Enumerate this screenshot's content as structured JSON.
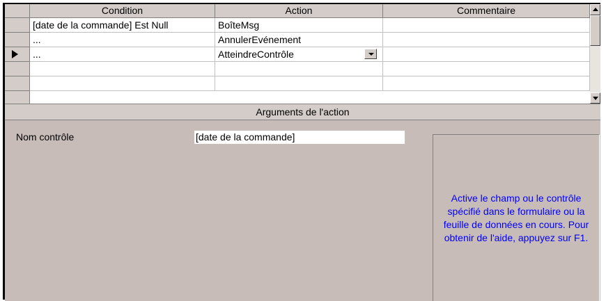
{
  "grid": {
    "columns": [
      "Condition",
      "Action",
      "Commentaire"
    ],
    "rows": [
      {
        "condition": "[date de la commande] Est Null",
        "action": "BoîteMsg",
        "comment": ""
      },
      {
        "condition": "...",
        "action": "AnnulerEvénement",
        "comment": ""
      },
      {
        "condition": "...",
        "action": "AtteindreContrôle",
        "comment": ""
      },
      {
        "condition": "",
        "action": "",
        "comment": ""
      },
      {
        "condition": "",
        "action": "",
        "comment": ""
      }
    ],
    "current_row_index": 2
  },
  "arguments": {
    "header": "Arguments de l'action",
    "field_label": "Nom contrôle",
    "field_value": "[date de la commande]",
    "help_text": "Active le champ ou le contrôle spécifié dans le formulaire ou la feuille de données en cours. Pour obtenir de l'aide, appuyez sur F1."
  },
  "icons": {
    "current_row": "row-pointer-icon",
    "dropdown": "chevron-down-icon",
    "scroll_up": "scroll-up-arrow-icon",
    "scroll_down": "scroll-down-arrow-icon"
  },
  "colors": {
    "panel_bg": "#d4ccc8",
    "help_text": "#0000ff"
  }
}
